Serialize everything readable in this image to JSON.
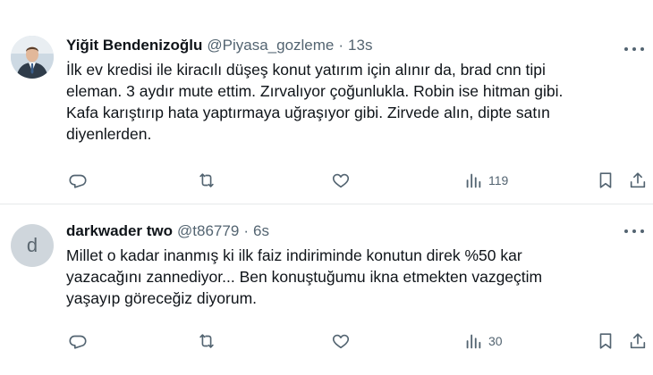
{
  "tweets": [
    {
      "display_name": "Yiğit Bendenizoğlu",
      "handle": "@Piyasa_gozleme",
      "separator": "·",
      "time": "13s",
      "avatar": "photo",
      "text": "İlk ev kredisi ile kiracılı düşeş konut yatırım için alınır da, brad cnn tipi\neleman. 3 aydır mute ettim. Zırvalıyor çoğunlukla. Robin ise hitman gibi.\nKafa karıştırıp hata yaptırmaya uğraşıyor gibi. Zirvede alın, dipte satın\ndiyenlerden.",
      "views": "119"
    },
    {
      "display_name": "darkwader two",
      "handle": "@t86779",
      "separator": "·",
      "time": "6s",
      "avatar_letter": "d",
      "text": "Millet o kadar inanmış ki ilk faiz indiriminde konutun direk %50 kar\nyazacağını zannediyor... Ben konuştuğumu ikna etmekten vazgeçtim\nyaşayıp göreceğiz diyorum.",
      "views": "30"
    }
  ],
  "icons": {
    "reply": "reply-icon",
    "retweet": "retweet-icon",
    "like": "heart-icon",
    "views": "views-chart-icon",
    "bookmark": "bookmark-icon",
    "share": "share-icon",
    "more": "more-dots-icon"
  },
  "colors": {
    "text_primary": "#0f1419",
    "text_secondary": "#536471",
    "divider": "#e6e9ea"
  }
}
